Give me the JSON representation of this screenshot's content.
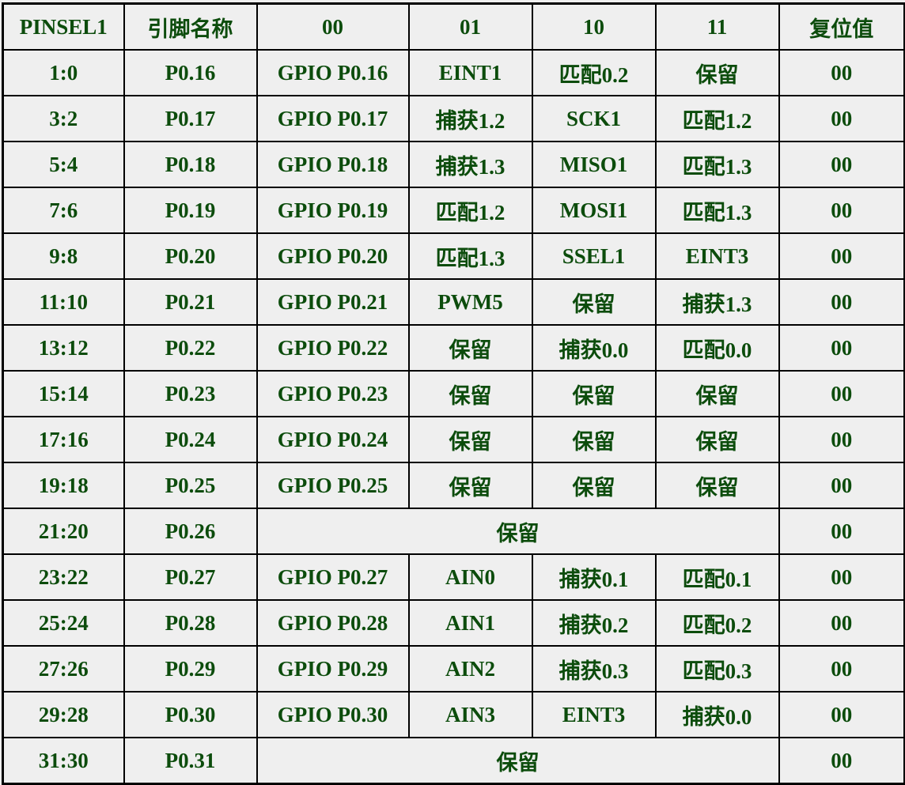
{
  "table": {
    "headers": [
      "PINSEL1",
      "引脚名称",
      "00",
      "01",
      "10",
      "11",
      "复位值"
    ],
    "rows": [
      {
        "bits": "1:0",
        "pin": "P0.16",
        "f00": "GPIO P0.16",
        "f01": "EINT1",
        "f10": "匹配0.2",
        "f11": "保留",
        "reset": "00"
      },
      {
        "bits": "3:2",
        "pin": "P0.17",
        "f00": "GPIO P0.17",
        "f01": "捕获1.2",
        "f10": "SCK1",
        "f11": "匹配1.2",
        "reset": "00"
      },
      {
        "bits": "5:4",
        "pin": "P0.18",
        "f00": "GPIO P0.18",
        "f01": "捕获1.3",
        "f10": "MISO1",
        "f11": "匹配1.3",
        "reset": "00"
      },
      {
        "bits": "7:6",
        "pin": "P0.19",
        "f00": "GPIO P0.19",
        "f01": "匹配1.2",
        "f10": "MOSI1",
        "f11": "匹配1.3",
        "reset": "00"
      },
      {
        "bits": "9:8",
        "pin": "P0.20",
        "f00": "GPIO P0.20",
        "f01": "匹配1.3",
        "f10": "SSEL1",
        "f11": "EINT3",
        "reset": "00"
      },
      {
        "bits": "11:10",
        "pin": "P0.21",
        "f00": "GPIO P0.21",
        "f01": "PWM5",
        "f10": "保留",
        "f11": "捕获1.3",
        "reset": "00"
      },
      {
        "bits": "13:12",
        "pin": "P0.22",
        "f00": "GPIO P0.22",
        "f01": "保留",
        "f10": "捕获0.0",
        "f11": "匹配0.0",
        "reset": "00"
      },
      {
        "bits": "15:14",
        "pin": "P0.23",
        "f00": "GPIO P0.23",
        "f01": "保留",
        "f10": "保留",
        "f11": "保留",
        "reset": "00"
      },
      {
        "bits": "17:16",
        "pin": "P0.24",
        "f00": "GPIO P0.24",
        "f01": "保留",
        "f10": "保留",
        "f11": "保留",
        "reset": "00"
      },
      {
        "bits": "19:18",
        "pin": "P0.25",
        "f00": "GPIO P0.25",
        "f01": "保留",
        "f10": "保留",
        "f11": "保留",
        "reset": "00"
      },
      {
        "bits": "21:20",
        "pin": "P0.26",
        "merged": "保留",
        "reset": "00"
      },
      {
        "bits": "23:22",
        "pin": "P0.27",
        "f00": "GPIO P0.27",
        "f01": "AIN0",
        "f10": "捕获0.1",
        "f11": "匹配0.1",
        "reset": "00"
      },
      {
        "bits": "25:24",
        "pin": "P0.28",
        "f00": "GPIO P0.28",
        "f01": "AIN1",
        "f10": "捕获0.2",
        "f11": "匹配0.2",
        "reset": "00"
      },
      {
        "bits": "27:26",
        "pin": "P0.29",
        "f00": "GPIO P0.29",
        "f01": "AIN2",
        "f10": "捕获0.3",
        "f11": "匹配0.3",
        "reset": "00"
      },
      {
        "bits": "29:28",
        "pin": "P0.30",
        "f00": "GPIO P0.30",
        "f01": "AIN3",
        "f10": "EINT3",
        "f11": "捕获0.0",
        "reset": "00"
      },
      {
        "bits": "31:30",
        "pin": "P0.31",
        "merged": "保留",
        "reset": "00"
      }
    ]
  },
  "colors": {
    "text": "#0c4c0c",
    "background": "#efefef",
    "border": "#000000"
  }
}
